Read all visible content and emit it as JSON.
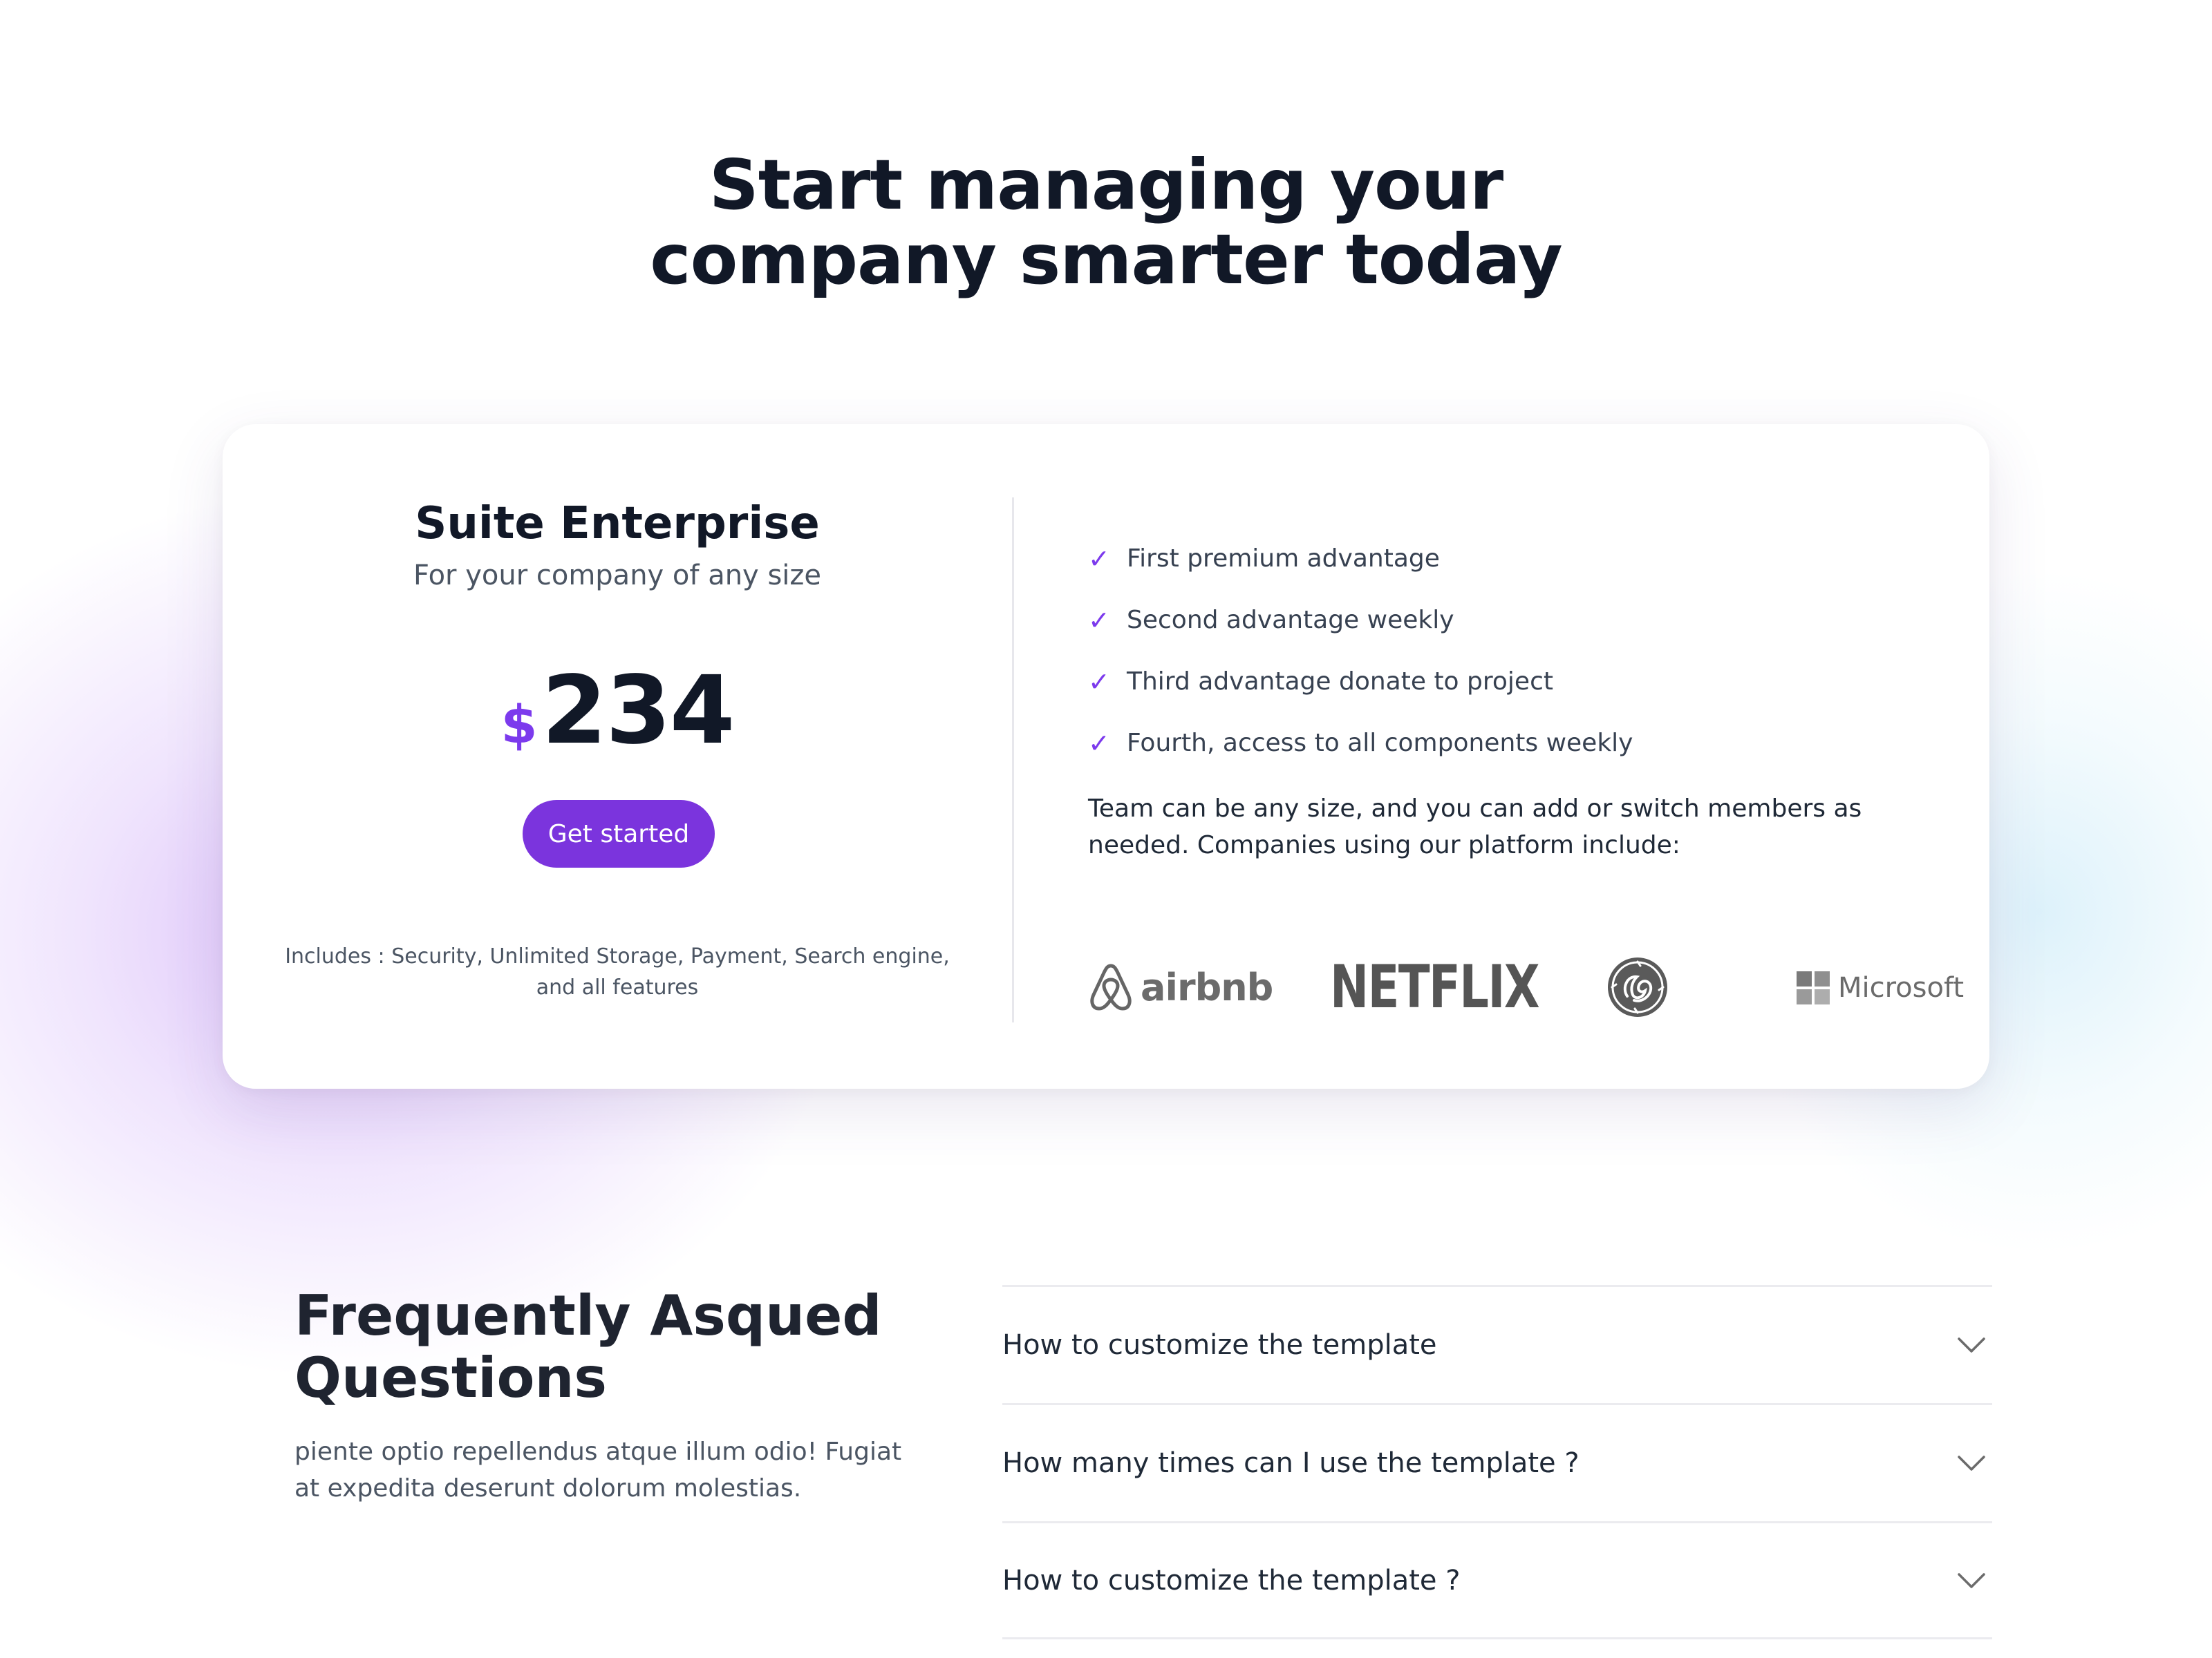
{
  "hero": {
    "title_line1": "Start managing your",
    "title_line2": "company smarter today"
  },
  "pricing": {
    "plan_name": "Suite Enterprise",
    "plan_subtitle": "For your company of any size",
    "currency": "$",
    "amount": "234",
    "cta_label": "Get started",
    "includes": "Includes : Security, Unlimited Storage, Payment, Search engine, and all features",
    "features": [
      "First premium advantage",
      "Second advantage weekly",
      "Third advantage donate to project",
      "Fourth, access to all components weekly"
    ],
    "team_text": "Team can be any size, and you can add or switch members as needed. Companies using our platform include:",
    "logos": {
      "airbnb": "airbnb",
      "netflix": "NETFLIX",
      "ge": "GE",
      "microsoft": "Microsoft"
    }
  },
  "faq": {
    "title_line1": "Frequently Asqued",
    "title_line2": "Questions",
    "description": "piente optio repellendus atque illum odio! Fugiat at expedita deserunt dolorum molestias.",
    "items": [
      "How to customize the template",
      "How many times can I use the template ?",
      "How to customize the template ?"
    ]
  },
  "colors": {
    "accent": "#7b34dd",
    "heading": "#111827",
    "body_text": "#4b5563",
    "divider": "#ebebef",
    "logo_gray": "#5f5f5f"
  }
}
